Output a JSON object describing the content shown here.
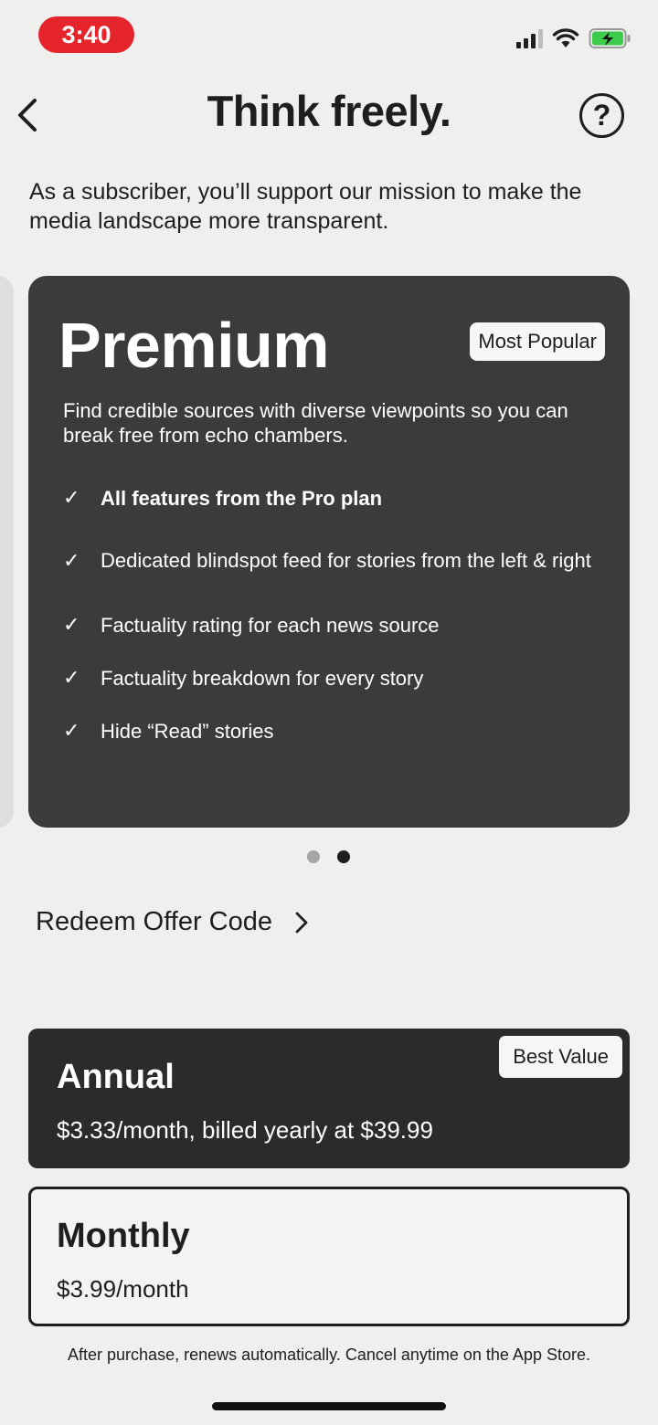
{
  "status_bar": {
    "time": "3:40",
    "battery_state": "charging",
    "accent_color": "#e5242c"
  },
  "header": {
    "title": "Think freely.",
    "back_icon": "chevron-left-icon",
    "help_label": "?"
  },
  "subtitle": "As a subscriber, you’ll support our mission to make the media landscape more transparent.",
  "carousel": {
    "page_count": 2,
    "active_index": 1,
    "plan": {
      "name": "Premium",
      "badge": "Most Popular",
      "description": "Find credible sources with diverse viewpoints so you can break free from echo chambers.",
      "features": [
        {
          "text": "All features from the Pro plan",
          "bold": true
        },
        {
          "text": "Dedicated blindspot feed for stories from the left & right",
          "bold": false
        },
        {
          "text": "Factuality rating for each news source",
          "bold": false
        },
        {
          "text": "Factuality breakdown for every story",
          "bold": false
        },
        {
          "text": "Hide “Read” stories",
          "bold": false
        }
      ]
    }
  },
  "redeem": {
    "label": "Redeem Offer Code",
    "icon": "chevron-right-icon"
  },
  "pricing": {
    "annual": {
      "name": "Annual",
      "price": "$3.33/month, billed yearly at $39.99",
      "badge": "Best Value",
      "selected": true
    },
    "monthly": {
      "name": "Monthly",
      "price": "$3.99/month",
      "selected": false
    }
  },
  "fine_print": "After purchase, renews automatically. Cancel anytime on the App Store."
}
